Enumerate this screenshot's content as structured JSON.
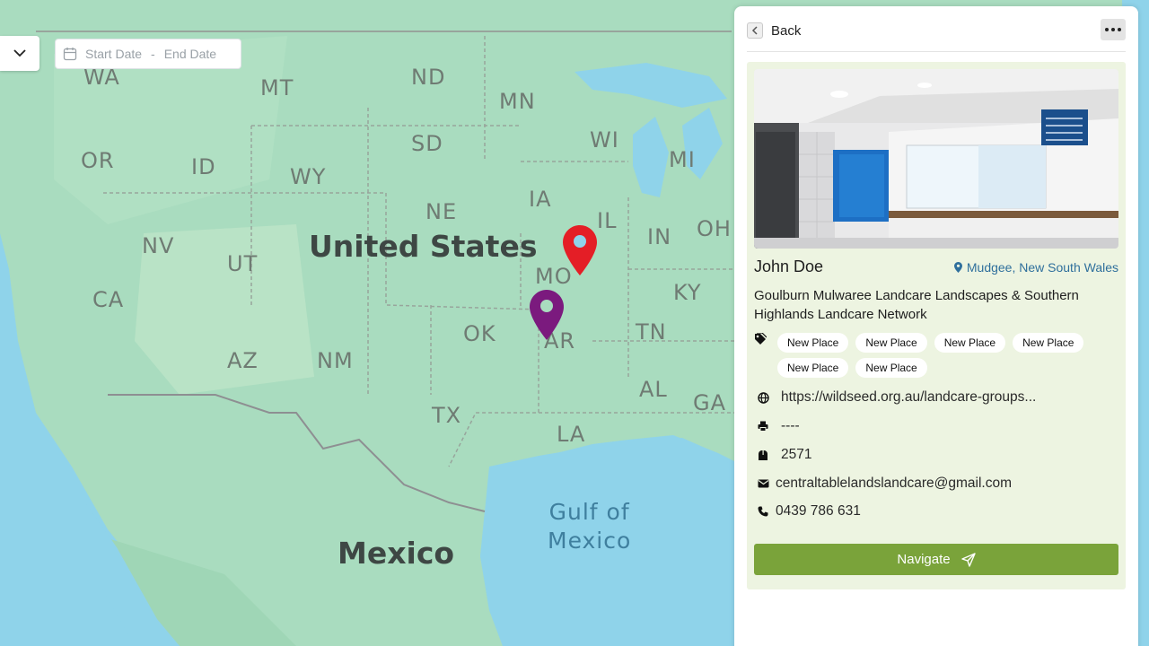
{
  "filter": {
    "start_placeholder": "Start Date",
    "separator": "-",
    "end_placeholder": "End Date"
  },
  "map": {
    "country_labels": [
      "United States",
      "Mexico"
    ],
    "water_label_line1": "Gulf of",
    "water_label_line2": "Mexico",
    "state_labels": [
      "WA",
      "MT",
      "ND",
      "MN",
      "OR",
      "ID",
      "SD",
      "WI",
      "MI",
      "WY",
      "IA",
      "NE",
      "IL",
      "IN",
      "OH",
      "NV",
      "UT",
      "MO",
      "KY",
      "CA",
      "OK",
      "AR",
      "TN",
      "AZ",
      "NM",
      "AL",
      "GA",
      "TX",
      "LA"
    ]
  },
  "panel": {
    "back_label": "Back",
    "name": "John Doe",
    "location": "Mudgee, New South Wales",
    "organization": "Goulburn Mulwaree Landcare Landscapes & Southern Highlands Landcare Network",
    "tags": [
      "New Place",
      "New Place",
      "New Place",
      "New Place",
      "New Place",
      "New Place"
    ],
    "website": "https://wildseed.org.au/landcare-groups...",
    "fax": "----",
    "postcode": "2571",
    "email": "centraltablelandslandcare@gmail.com",
    "phone": "0439 786 631",
    "navigate_label": "Navigate"
  },
  "colors": {
    "accent_green": "#7aa33a",
    "card_bg": "#edf4e1",
    "link_blue": "#2f6f9c",
    "marker_red": "#e41e26",
    "marker_purple": "#7b1a7e"
  },
  "icons": [
    "chevron-down-icon",
    "calendar-icon",
    "map-pin-red-icon",
    "map-pin-purple-icon",
    "chevron-left-icon",
    "more-icon",
    "location-pin-icon",
    "tag-icon",
    "globe-icon",
    "fax-icon",
    "postbox-icon",
    "mail-icon",
    "phone-icon",
    "send-icon"
  ]
}
